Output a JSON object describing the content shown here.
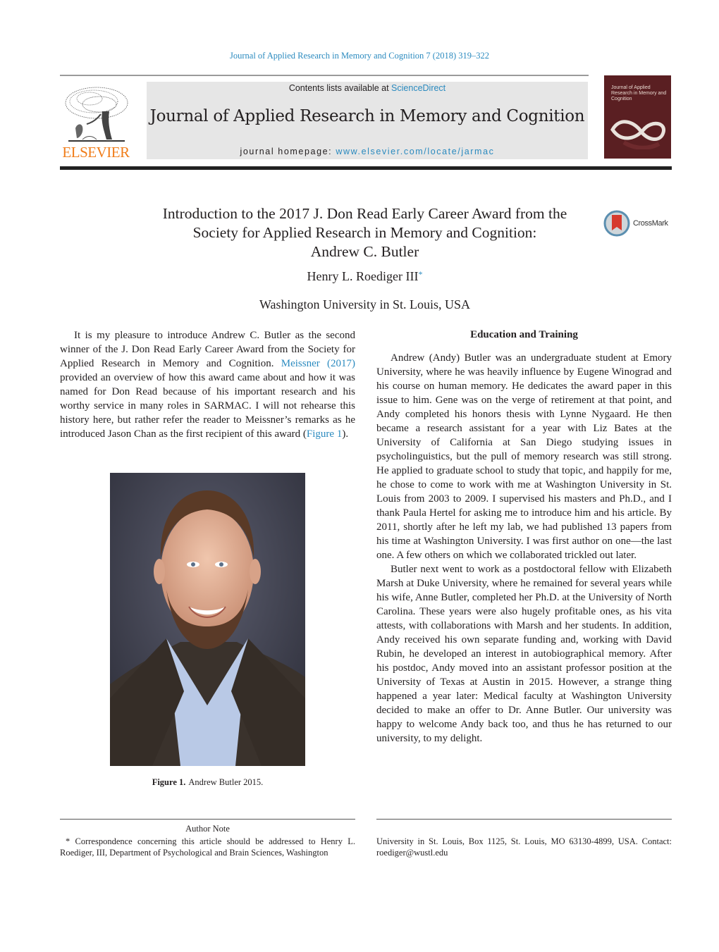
{
  "running_head": "Journal of Applied Research in Memory and Cognition 7 (2018) 319–322",
  "masthead": {
    "logo_text": "ELSEVIER",
    "contents_prefix": "Contents lists available at ",
    "contents_link": "ScienceDirect",
    "journal_name": "Journal of Applied Research in Memory and Cognition",
    "homepage_prefix": "journal homepage: ",
    "homepage_link": "www.elsevier.com/locate/jarmac",
    "cover_title": "Journal of Applied Research in Memory and Cognition",
    "cover_color": "#5a1f22",
    "logo_color": "#f07d1a",
    "link_color": "#2a8abf"
  },
  "article": {
    "title_lines": [
      "Introduction to the 2017 J. Don Read Early Career Award from the",
      "Society for Applied Research in Memory and Cognition:",
      "Andrew C. Butler"
    ],
    "author": "Henry L. Roediger III",
    "author_mark": "*",
    "affiliation": "Washington University in St. Louis, USA",
    "crossmark_label": "CrossMark"
  },
  "left_column": {
    "intro_part1": "It is my pleasure to introduce Andrew C. Butler as the second winner of the J. Don Read Early Career Award from the Society for Applied Research in Memory and Cognition. ",
    "intro_link1": "Meissner (2017)",
    "intro_part2": " provided an overview of how this award came about and how it was named for Don Read because of his important research and his worthy service in many roles in SARMAC. I will not rehearse this history here, but rather refer the reader to Meissner’s remarks as he introduced Jason Chan as the first recipient of this award (",
    "intro_link2": "Figure 1",
    "intro_part3": ").",
    "figure_label": "Figure 1.",
    "figure_caption": "Andrew Butler 2015."
  },
  "right_column": {
    "section_heading": "Education and Training",
    "paragraphs": [
      "Andrew (Andy) Butler was an undergraduate student at Emory University, where he was heavily influence by Eugene Winograd and his course on human memory. He dedicates the award paper in this issue to him. Gene was on the verge of retirement at that point, and Andy completed his honors thesis with Lynne Nygaard. He then became a research assistant for a year with Liz Bates at the University of California at San Diego studying issues in psycholinguistics, but the pull of memory research was still strong. He applied to graduate school to study that topic, and happily for me, he chose to come to work with me at Washington University in St. Louis from 2003 to 2009. I supervised his masters and Ph.D., and I thank Paula Hertel for asking me to introduce him and his article. By 2011, shortly after he left my lab, we had published 13 papers from his time at Washington University. I was first author on one—the last one. A few others on which we collaborated trickled out later.",
      "Butler next went to work as a postdoctoral fellow with Elizabeth Marsh at Duke University, where he remained for several years while his wife, Anne Butler, completed her Ph.D. at the University of North Carolina. These years were also hugely profitable ones, as his vita attests, with collaborations with Marsh and her students. In addition, Andy received his own separate funding and, working with David Rubin, he developed an interest in autobiographical memory. After his postdoc, Andy moved into an assistant professor position at the University of Texas at Austin in 2015. However, a strange thing happened a year later: Medical faculty at Washington University decided to make an offer to Dr. Anne Butler. Our university was happy to welcome Andy back too, and thus he has returned to our university, to my delight."
    ]
  },
  "footer": {
    "author_note_title": "Author Note",
    "footnote_left": "* Correspondence concerning this article should be addressed to Henry L. Roediger, III, Department of Psychological and Brain Sciences, Washington",
    "footnote_right": "University in St. Louis, Box 1125, St. Louis, MO 63130-4899, USA. Contact: roediger@wustl.edu"
  }
}
